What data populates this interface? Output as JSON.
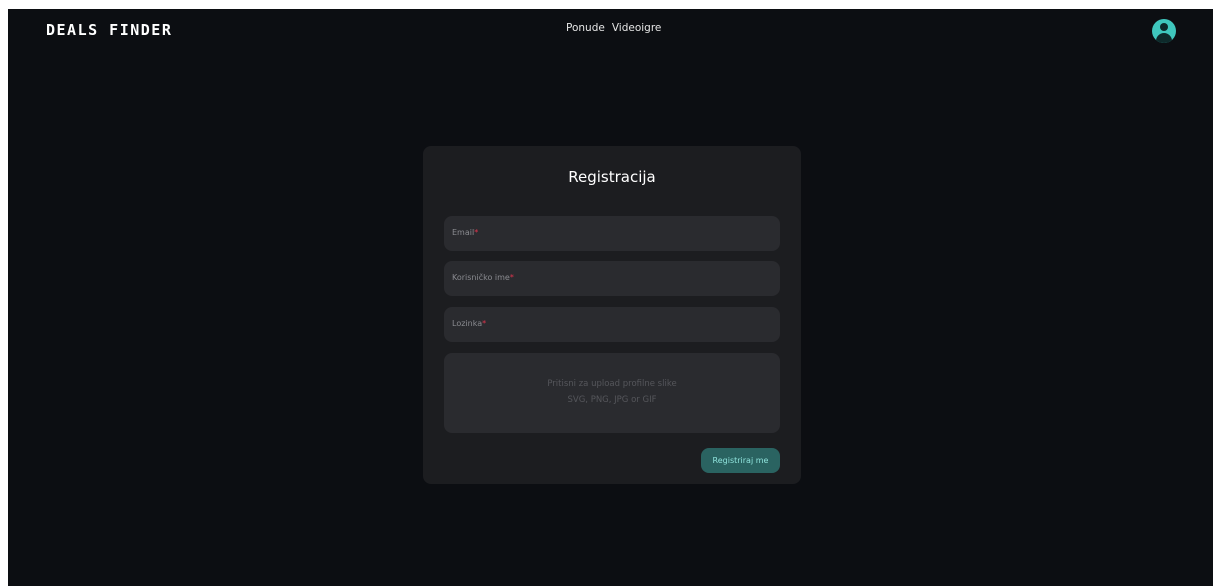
{
  "header": {
    "logo": "DEALS FINDER",
    "nav": [
      "Ponude",
      "Videoigre"
    ],
    "avatar_icon": "user-icon"
  },
  "register": {
    "title": "Registracija",
    "fields": [
      {
        "label": "Email",
        "required_mark": "*"
      },
      {
        "label": "Korisničko ime",
        "required_mark": "*"
      },
      {
        "label": "Lozinka",
        "required_mark": "*"
      }
    ],
    "upload": {
      "line1": "Pritisni za upload profilne slike",
      "line2": "SVG, PNG, JPG or GIF"
    },
    "submit_label": "Registriraj me"
  },
  "colors": {
    "background": "#0c0e12",
    "card": "#1c1d20",
    "field": "#2a2b2f",
    "accent": "#3fc7bd",
    "button": "#2a6361",
    "required": "#e0344d"
  }
}
